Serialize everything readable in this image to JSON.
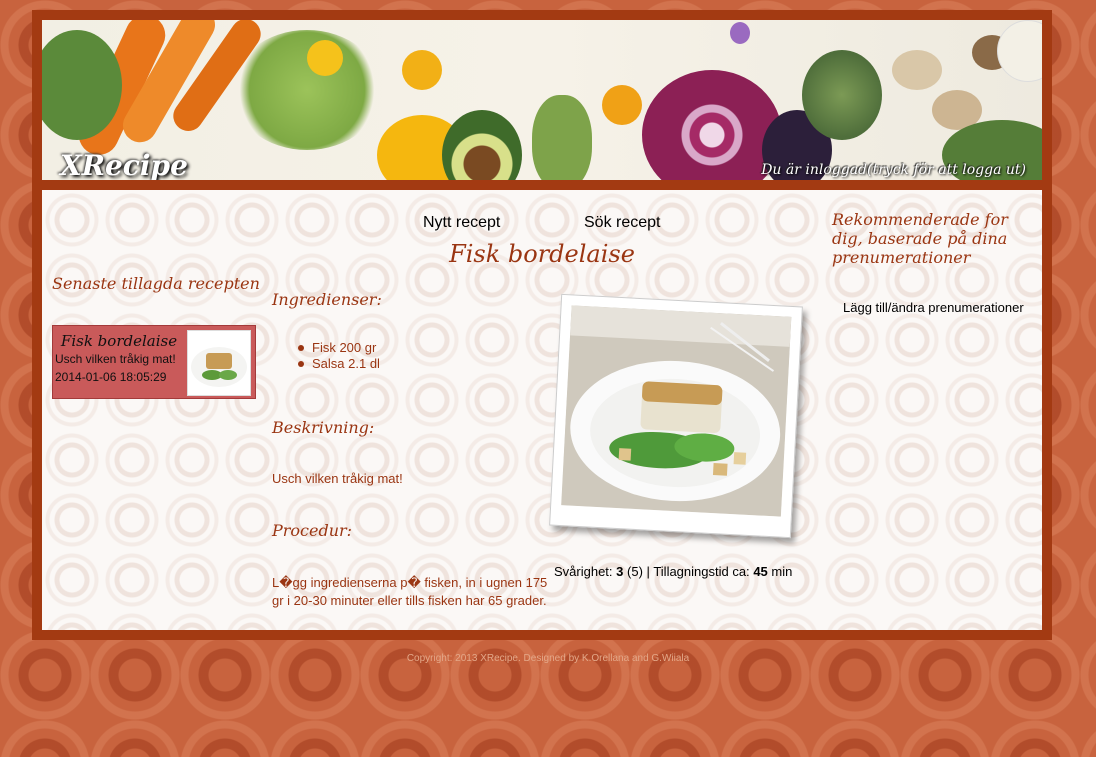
{
  "header": {
    "logo": "XRecipe",
    "login_status": "Du är inloggad(tryck för att logga ut)"
  },
  "nav": {
    "new_recipe": "Nytt recept",
    "search_recipe": "Sök recept"
  },
  "sidebar_left": {
    "heading": "Senaste tillagda recepten",
    "latest": {
      "title": "Fisk bordelaise",
      "description": "Usch vilken tråkig mat!",
      "timestamp": "2014-01-06 18:05:29"
    }
  },
  "recipe": {
    "title": "Fisk bordelaise",
    "ingredients_heading": "Ingredienser:",
    "ingredients": [
      "Fisk 200 gr",
      "Salsa 2.1 dl"
    ],
    "description_heading": "Beskrivning:",
    "description": "Usch vilken tråkig mat!",
    "procedure_heading": "Procedur:",
    "procedure": "L�gg ingredienserna p� fisken, in i ugnen 175 gr i 20-30 minuter eller tills fisken har 65 grader.",
    "difficulty_label": "Svårighet:",
    "difficulty_value": "3",
    "difficulty_max": "(5)",
    "separator": "|",
    "time_label": "Tillagningstid ca:",
    "time_value": "45",
    "time_unit": "min"
  },
  "sidebar_right": {
    "heading": "Rekommenderade for dig, baserade på dina prenumerationer",
    "link": "Lägg till/ändra prenumerationer"
  },
  "footer": {
    "text": "Copyright: 2013 XRecipe. Designed by K.Orellana and G.Wiiala"
  },
  "colors": {
    "accent": "#9a3512",
    "frame": "#a33a12",
    "card": "#c95a5a"
  }
}
